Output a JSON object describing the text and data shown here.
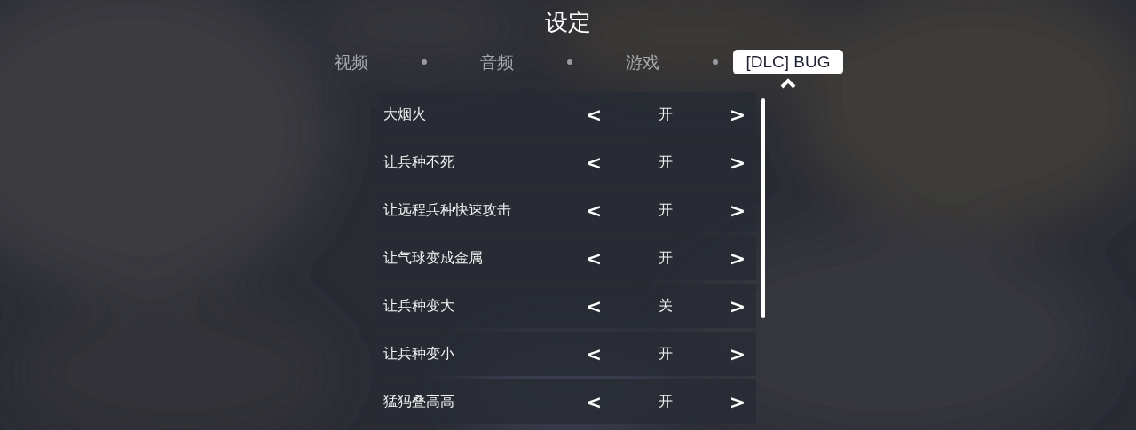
{
  "title": "设定",
  "tabs": [
    {
      "label": "视频",
      "selected": false
    },
    {
      "label": "音频",
      "selected": false
    },
    {
      "label": "游戏",
      "selected": false
    },
    {
      "label": "[DLC] BUG",
      "selected": true
    }
  ],
  "settings": [
    {
      "label": "大烟火",
      "prev": "<",
      "value": "开",
      "next": ">"
    },
    {
      "label": "让兵种不死",
      "prev": "<",
      "value": "开",
      "next": ">"
    },
    {
      "label": "让远程兵种快速攻击",
      "prev": "<",
      "value": "开",
      "next": ">"
    },
    {
      "label": "让气球变成金属",
      "prev": "<",
      "value": "开",
      "next": ">"
    },
    {
      "label": "让兵种变大",
      "prev": "<",
      "value": "关",
      "next": ">"
    },
    {
      "label": "让兵种变小",
      "prev": "<",
      "value": "开",
      "next": ">"
    },
    {
      "label": "猛犸叠高高",
      "prev": "<",
      "value": "开",
      "next": ">"
    }
  ]
}
